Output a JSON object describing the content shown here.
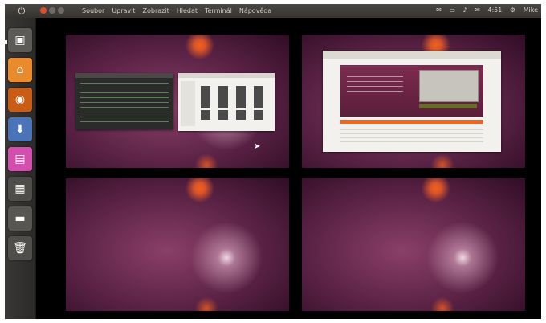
{
  "topbar": {
    "menu": [
      "Soubor",
      "Upravit",
      "Zobrazit",
      "Hledat",
      "Terminál",
      "Nápověda"
    ],
    "time": "4:51",
    "user": "Mike"
  },
  "launcher": {
    "items": [
      {
        "name": "workspace-switcher-icon",
        "color": "#6b6a67"
      },
      {
        "name": "home-folder-icon",
        "color": "#e98a2d"
      },
      {
        "name": "firefox-icon",
        "color": "#d96a1a"
      },
      {
        "name": "software-center-icon",
        "color": "#4b73b7"
      },
      {
        "name": "libreoffice-impress-icon",
        "color": "#d24fae"
      },
      {
        "name": "files-icon",
        "color": "#5b5a57"
      },
      {
        "name": "desktop-icon",
        "color": "#5f5e5b"
      },
      {
        "name": "trash-icon",
        "color": "#595856"
      }
    ]
  },
  "workspaces": [
    "workspace-1",
    "workspace-2",
    "workspace-3",
    "workspace-4"
  ]
}
